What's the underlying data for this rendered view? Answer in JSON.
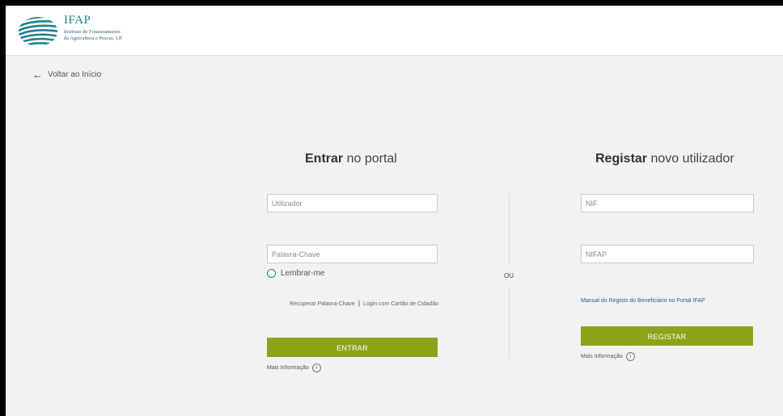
{
  "header": {
    "logo_title": "IFAP",
    "logo_subtitle_line1": "Instituto de Financiamento",
    "logo_subtitle_line2": "da Agricultura e Pescas, I.P.",
    "colors": {
      "teal": "#1c7f8f",
      "navy": "#2f5f78"
    }
  },
  "nav": {
    "back_label": "Voltar ao Início"
  },
  "login": {
    "heading_bold": "Entrar",
    "heading_rest": " no portal",
    "username_placeholder": "Utilizador",
    "password_placeholder": "Palavra-Chave",
    "remember_label": "Lembrar-me",
    "recover_link": "Recuperar Palavra-Chave",
    "citizen_card_link": "Login com Cartão de Cidadão",
    "submit_label": "ENTRAR",
    "more_info": "Mais Informação"
  },
  "separator_label": "OU",
  "register": {
    "heading_bold": "Registar",
    "heading_rest": " novo utilizador",
    "nif_placeholder": "NIF",
    "nifap_placeholder": "NIFAP",
    "manual_link": "Manual do Registo do Beneficiário no Portal IFAP",
    "submit_label": "REGISTAR",
    "more_info": "Mais Informação"
  },
  "colors": {
    "button": "#8ea31a",
    "accent": "#1a8a9a",
    "link": "#2a5a8a"
  },
  "icons": {
    "back": "arrow-left-icon",
    "info": "info-icon",
    "logo": "ifap-logo-icon"
  }
}
